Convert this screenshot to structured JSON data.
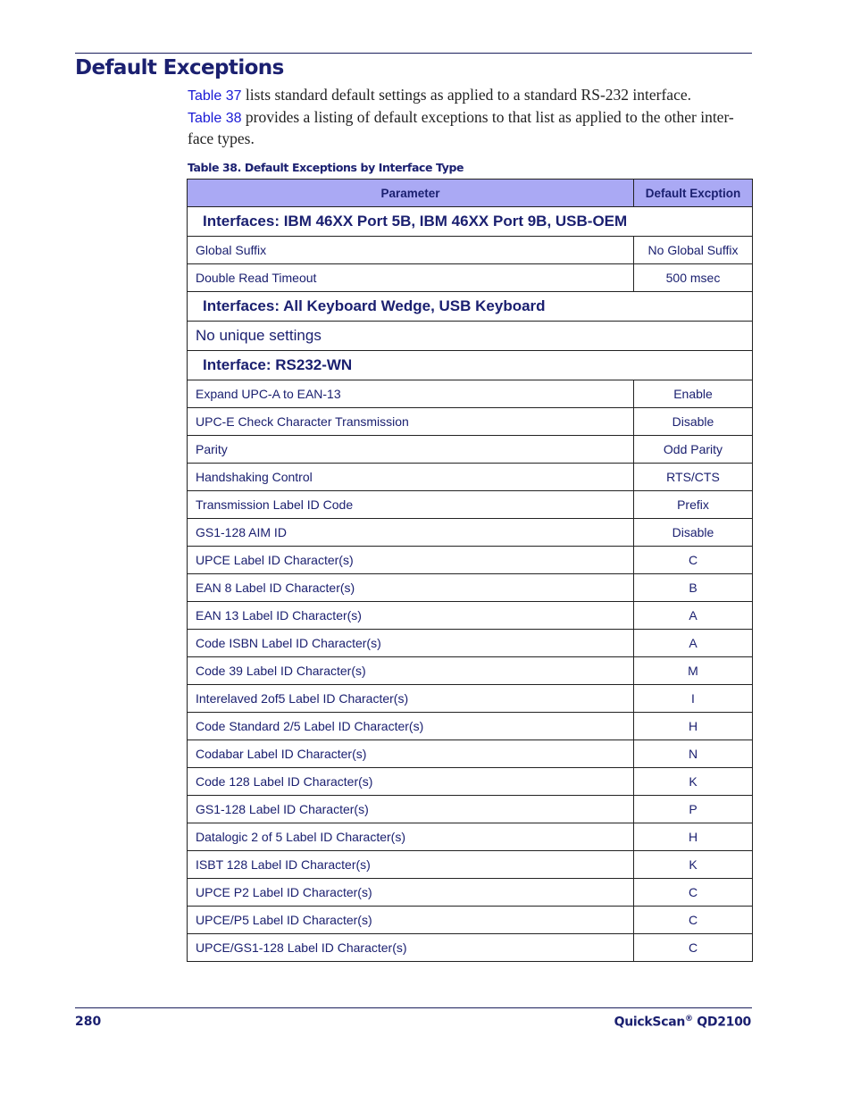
{
  "page": {
    "title": "Default Exceptions",
    "intro": {
      "link1": "Table 37",
      "text1": " lists standard default settings as applied to a standard RS-232 interface.",
      "link2": "Table 38",
      "text2": " provides a listing of default exceptions to that list as applied to the other inter-face types."
    },
    "caption": "Table 38. Default Exceptions by Interface Type"
  },
  "table": {
    "headers": [
      "Parameter",
      "Default Excption"
    ],
    "sections": [
      {
        "title": "Interfaces: IBM 46XX Port 5B, IBM 46XX Port 9B, USB-OEM",
        "rows": [
          {
            "parameter": "Global Suffix",
            "value": "No Global Suffix"
          },
          {
            "parameter": "Double Read Timeout",
            "value": "500 msec"
          }
        ]
      },
      {
        "title": "Interfaces: All Keyboard Wedge, USB Keyboard",
        "note": "No unique settings"
      },
      {
        "title": "Interface: RS232-WN",
        "rows": [
          {
            "parameter": "Expand UPC-A to EAN-13",
            "value": "Enable"
          },
          {
            "parameter": "UPC-E Check Character Transmission",
            "value": "Disable"
          },
          {
            "parameter": "Parity",
            "value": "Odd Parity"
          },
          {
            "parameter": "Handshaking Control",
            "value": "RTS/CTS"
          },
          {
            "parameter": "Transmission Label ID Code",
            "value": "Prefix"
          },
          {
            "parameter": "GS1-128 AIM ID",
            "value": "Disable"
          },
          {
            "parameter": "UPCE Label ID Character(s)",
            "value": "C"
          },
          {
            "parameter": "EAN 8 Label ID Character(s)",
            "value": "B"
          },
          {
            "parameter": "EAN 13 Label ID Character(s)",
            "value": "A"
          },
          {
            "parameter": "Code ISBN Label ID Character(s)",
            "value": "A"
          },
          {
            "parameter": "Code 39 Label ID Character(s)",
            "value": "M"
          },
          {
            "parameter": "Interelaved 2of5 Label ID Character(s)",
            "value": "I"
          },
          {
            "parameter": "Code Standard 2/5 Label ID Character(s)",
            "value": "H"
          },
          {
            "parameter": "Codabar Label ID Character(s)",
            "value": "N"
          },
          {
            "parameter": "Code 128 Label ID Character(s)",
            "value": "K"
          },
          {
            "parameter": "GS1-128 Label ID Character(s)",
            "value": "P"
          },
          {
            "parameter": "Datalogic 2 of 5 Label ID Character(s)",
            "value": "H"
          },
          {
            "parameter": "ISBT 128 Label ID Character(s)",
            "value": "K"
          },
          {
            "parameter": "UPCE P2 Label ID Character(s)",
            "value": "C"
          },
          {
            "parameter": "UPCE/P5 Label ID Character(s)",
            "value": "C"
          },
          {
            "parameter": "UPCE/GS1-128 Label ID Character(s)",
            "value": "C"
          }
        ]
      }
    ]
  },
  "footer": {
    "page_number": "280",
    "product_name": "QuickScan",
    "product_mark": "®",
    "product_model": " QD2100"
  },
  "colors": {
    "heading": "#1b2070",
    "link": "#1a1ad6",
    "header_fill": "#aaa9f4"
  }
}
